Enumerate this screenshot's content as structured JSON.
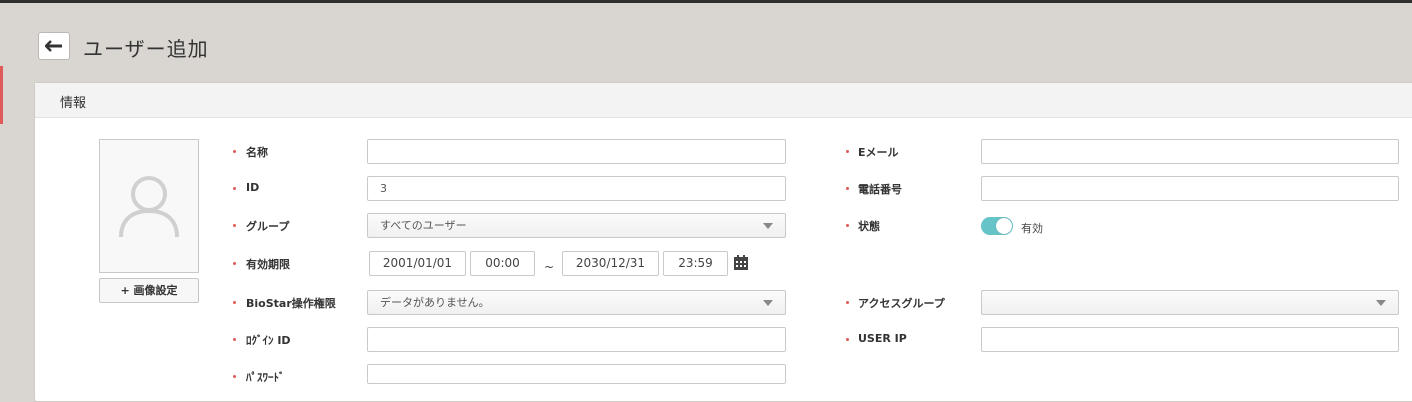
{
  "page": {
    "title": "ユーザー追加"
  },
  "panel": {
    "title": "情報"
  },
  "photo": {
    "button_label": "+ 画像設定"
  },
  "fields": {
    "name": {
      "label": "名称",
      "value": ""
    },
    "id": {
      "label": "ID",
      "value": "3"
    },
    "group": {
      "label": "グループ",
      "value": "すべてのユーザー"
    },
    "validity": {
      "label": "有効期限",
      "start_date": "2001/01/01",
      "start_time": "00:00",
      "separator": "~",
      "end_date": "2030/12/31",
      "end_time": "23:59"
    },
    "biostar_permission": {
      "label": "BioStar操作権限",
      "value": "データがありません。"
    },
    "login_id": {
      "label": "ﾛｸﾞｲﾝ ID",
      "value": ""
    },
    "password": {
      "label": "ﾊﾟｽﾜｰﾄﾞ",
      "value": ""
    },
    "email": {
      "label": "Eメール",
      "value": ""
    },
    "phone": {
      "label": "電話番号",
      "value": ""
    },
    "status": {
      "label": "状態",
      "value": "有効",
      "enabled": true
    },
    "access_group": {
      "label": "アクセスグループ",
      "value": ""
    },
    "user_ip": {
      "label": "USER IP",
      "value": ""
    }
  },
  "colors": {
    "required_bullet": "#e05a5a",
    "toggle_on": "#66c3c7",
    "background": "#d9d5d1"
  },
  "icons": [
    "back-arrow-icon",
    "user-placeholder-icon",
    "calendar-icon",
    "dropdown-caret-icon"
  ]
}
